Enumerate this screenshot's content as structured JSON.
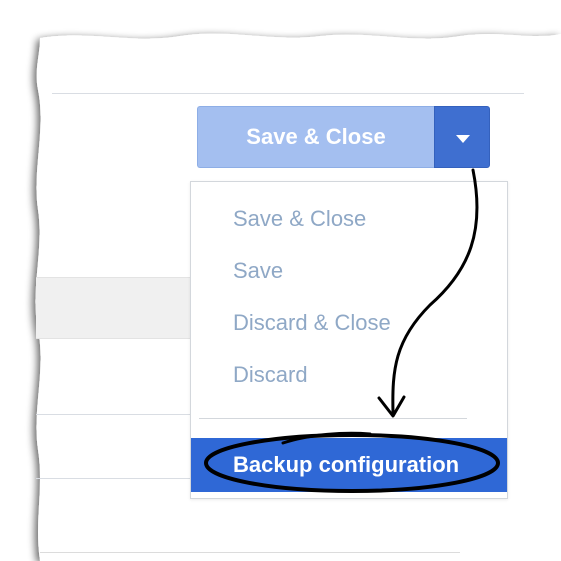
{
  "toolbar": {
    "split_button": {
      "label": "Save & Close",
      "main_color": "#a4bff0",
      "caret_color": "#3f6fd0",
      "caret_icon": "chevron-down-icon"
    }
  },
  "dropdown": {
    "items": [
      {
        "label": "Save & Close"
      },
      {
        "label": "Save"
      },
      {
        "label": "Discard & Close"
      },
      {
        "label": "Discard"
      }
    ],
    "highlighted": {
      "label": "Backup configuration",
      "color": "#2f68d6"
    }
  },
  "annotation": {
    "type": "hand-drawn arrow and ellipse",
    "color": "#000000",
    "target": "Backup configuration"
  }
}
